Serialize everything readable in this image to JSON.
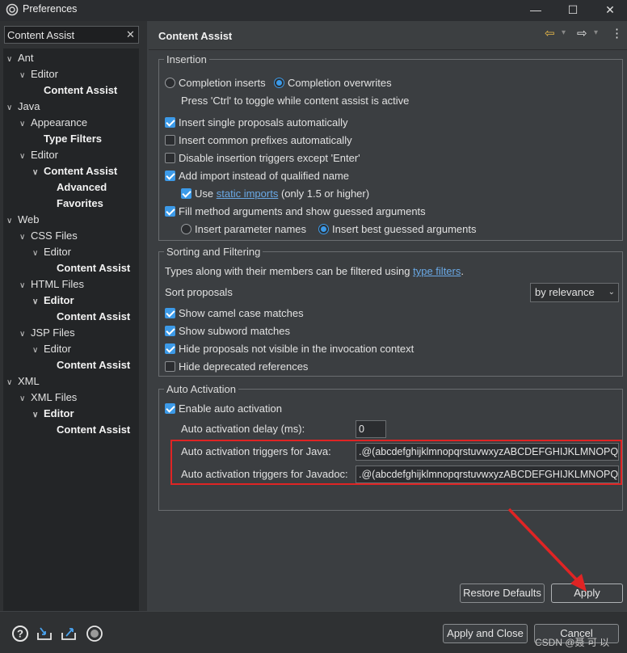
{
  "window": {
    "title": "Preferences",
    "minimize": "—",
    "maximize": "☐",
    "close": "✕"
  },
  "filter": {
    "value": "Content Assist",
    "clear": "✕"
  },
  "tree": [
    {
      "label": "Ant",
      "twisty": "∨",
      "bold": false
    },
    {
      "label": "Editor",
      "twisty": "∨",
      "bold": false
    },
    {
      "label": "Content Assist",
      "twisty": "",
      "bold": true
    },
    {
      "label": "Java",
      "twisty": "∨",
      "bold": false
    },
    {
      "label": "Appearance",
      "twisty": "∨",
      "bold": false
    },
    {
      "label": "Type Filters",
      "twisty": "",
      "bold": true
    },
    {
      "label": "Editor",
      "twisty": "∨",
      "bold": false
    },
    {
      "label": "Content Assist",
      "twisty": "∨",
      "bold": true
    },
    {
      "label": "Advanced",
      "twisty": "",
      "bold": true
    },
    {
      "label": "Favorites",
      "twisty": "",
      "bold": true
    },
    {
      "label": "Web",
      "twisty": "∨",
      "bold": false
    },
    {
      "label": "CSS Files",
      "twisty": "∨",
      "bold": false
    },
    {
      "label": "Editor",
      "twisty": "∨",
      "bold": false
    },
    {
      "label": "Content Assist",
      "twisty": "",
      "bold": true
    },
    {
      "label": "HTML Files",
      "twisty": "∨",
      "bold": false
    },
    {
      "label": "Editor",
      "twisty": "∨",
      "bold": true
    },
    {
      "label": "Content Assist",
      "twisty": "",
      "bold": true
    },
    {
      "label": "JSP Files",
      "twisty": "∨",
      "bold": false
    },
    {
      "label": "Editor",
      "twisty": "∨",
      "bold": false
    },
    {
      "label": "Content Assist",
      "twisty": "",
      "bold": true
    },
    {
      "label": "XML",
      "twisty": "∨",
      "bold": false
    },
    {
      "label": "XML Files",
      "twisty": "∨",
      "bold": false
    },
    {
      "label": "Editor",
      "twisty": "∨",
      "bold": true
    },
    {
      "label": "Content Assist",
      "twisty": "",
      "bold": true
    }
  ],
  "page": {
    "title": "Content Assist",
    "back_icon": "⇦",
    "forward_icon": "⇨",
    "dropdown_icon": "▾",
    "menu_icon": "⋮"
  },
  "insertion": {
    "legend": "Insertion",
    "completion_inserts": "Completion inserts",
    "completion_overwrites": "Completion overwrites",
    "toggle_hint": "Press 'Ctrl' to toggle while content assist is active",
    "insert_single": "Insert single proposals automatically",
    "insert_common": "Insert common prefixes automatically",
    "disable_triggers": "Disable insertion triggers except 'Enter'",
    "add_import": "Add import instead of qualified name",
    "use_label": "Use",
    "static_imports": "static imports",
    "static_suffix": "(only 1.5 or higher)",
    "fill_args": "Fill method arguments and show guessed arguments",
    "insert_param_names": "Insert parameter names",
    "insert_best_guessed": "Insert best guessed arguments"
  },
  "sorting": {
    "legend": "Sorting and Filtering",
    "types_text": "Types along with their members can be filtered using",
    "type_filters_link": "type filters",
    "period": ".",
    "sort_label": "Sort proposals",
    "sort_value": "by relevance",
    "camel": "Show camel case matches",
    "subword": "Show subword matches",
    "hide_invisible": "Hide proposals not visible in the invocation context",
    "hide_deprecated": "Hide deprecated references"
  },
  "auto": {
    "legend": "Auto Activation",
    "enable": "Enable auto activation",
    "delay_label": "Auto activation delay (ms):",
    "delay_value": "0",
    "java_label": "Auto activation triggers for Java:",
    "java_value": ".@(abcdefghijklmnopqrstuvwxyzABCDEFGHIJKLMNOPQ",
    "javadoc_label": "Auto activation triggers for Javadoc:",
    "javadoc_value": ".@(abcdefghijklmnopqrstuvwxyzABCDEFGHIJKLMNOPQ"
  },
  "buttons": {
    "restore": "Restore Defaults",
    "apply": "Apply",
    "apply_close": "Apply and Close",
    "cancel": "Cancel"
  },
  "bottom_icons": [
    "help-icon",
    "import-icon",
    "export-icon",
    "record-icon"
  ],
  "watermark": "CSDN @聂 可 以",
  "colors": {
    "accent": "#3c9ae8",
    "highlight": "#e02424",
    "link": "#6aa9e6"
  }
}
